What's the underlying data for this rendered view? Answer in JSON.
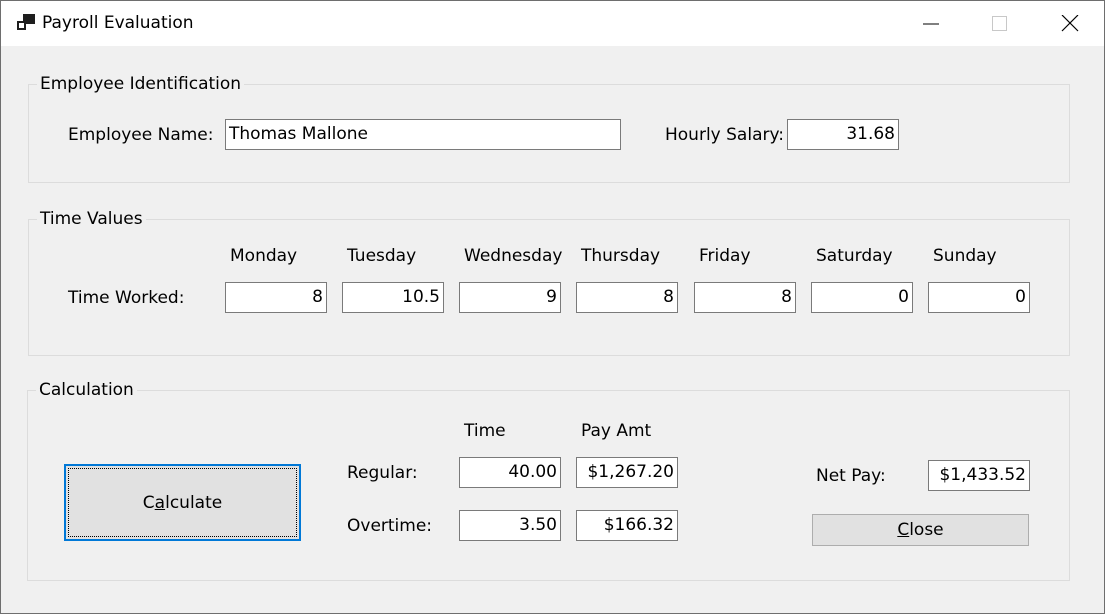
{
  "window": {
    "title": "Payroll Evaluation"
  },
  "identification": {
    "group_title": "Employee Identification",
    "name_label": "Employee Name:",
    "name_value": "Thomas Mallone",
    "salary_label": "Hourly Salary:",
    "salary_value": "31.68"
  },
  "time_values": {
    "group_title": "Time Values",
    "row_label": "Time Worked:",
    "days": [
      {
        "label": "Monday",
        "value": "8"
      },
      {
        "label": "Tuesday",
        "value": "10.5"
      },
      {
        "label": "Wednesday",
        "value": "9"
      },
      {
        "label": "Thursday",
        "value": "8"
      },
      {
        "label": "Friday",
        "value": "8"
      },
      {
        "label": "Saturday",
        "value": "0"
      },
      {
        "label": "Sunday",
        "value": "0"
      }
    ]
  },
  "calculation": {
    "group_title": "Calculation",
    "calculate_button": {
      "before": "C",
      "accel": "a",
      "after": "lculate"
    },
    "time_header": "Time",
    "pay_header": "Pay Amt",
    "regular_label": "Regular:",
    "regular_time": "40.00",
    "regular_pay": "$1,267.20",
    "overtime_label": "Overtime:",
    "overtime_time": "3.50",
    "overtime_pay": "$166.32",
    "net_pay_label": "Net Pay:",
    "net_pay_value": "$1,433.52",
    "close_button": {
      "accel": "C",
      "after": "lose"
    }
  }
}
